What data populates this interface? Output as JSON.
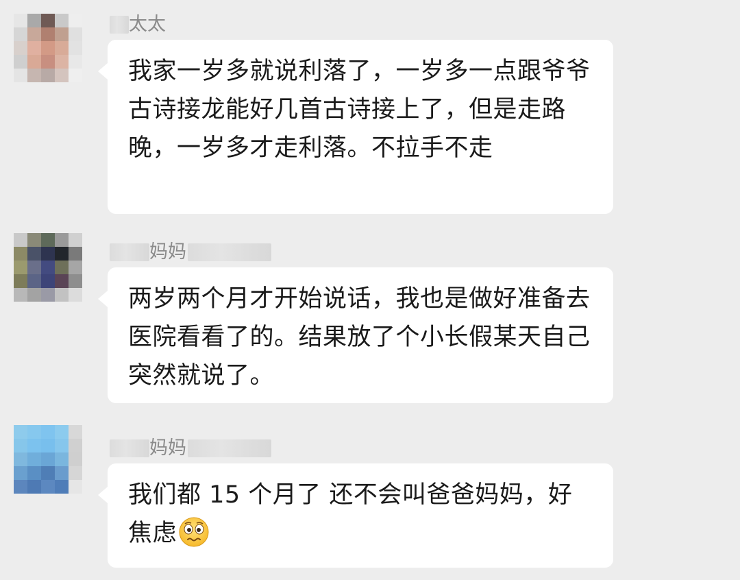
{
  "messages": [
    {
      "sender_visible": "太太",
      "text": "我家一岁多就说利落了，一岁多一点跟爷爷古诗接龙能好几首古诗接上了，但是走路晚，一岁多才走利落。不拉手不走"
    },
    {
      "sender_visible": "妈妈",
      "text": "两岁两个月才开始说话，我也是做好准备去医院看看了的。结果放了个小长假某天自己突然就说了。"
    },
    {
      "sender_visible": "妈妈",
      "text": "我们都 15 个月了 还不会叫爸爸妈妈，好焦虑",
      "emoji": "woozy-anxious-face"
    }
  ],
  "colors": {
    "background": "#ededed",
    "bubble": "#ffffff",
    "text": "#1a1a1a",
    "name": "#8b8b8b"
  }
}
